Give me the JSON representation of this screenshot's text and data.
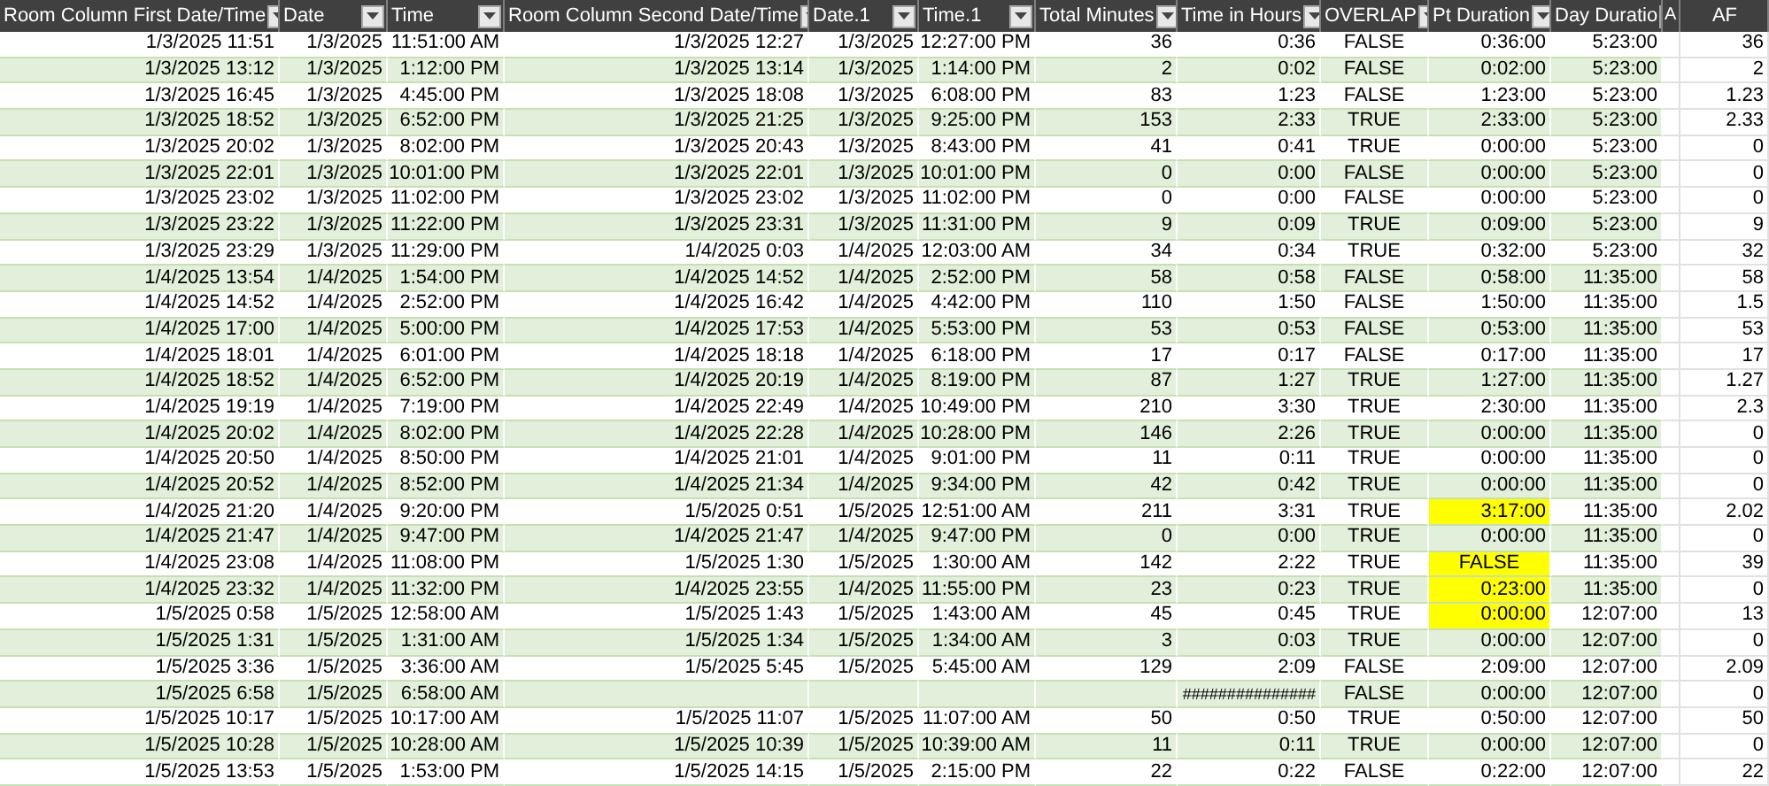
{
  "columns": [
    {
      "label": "Room Column First Date/Time",
      "filter": true
    },
    {
      "label": "Date",
      "filter": true
    },
    {
      "label": "Time",
      "filter": true
    },
    {
      "label": "Room Column Second Date/Time",
      "filter": true
    },
    {
      "label": "Date.1",
      "filter": true
    },
    {
      "label": "Time.1",
      "filter": true
    },
    {
      "label": "Total Minutes",
      "filter": true
    },
    {
      "label": "Time in Hours",
      "filter": true
    },
    {
      "label": "OVERLAP",
      "filter": true
    },
    {
      "label": "Pt Duration",
      "filter": true
    },
    {
      "label": "Day Duratio",
      "filter": true
    },
    {
      "label": "A",
      "filter": false,
      "kind": "narrow"
    },
    {
      "label": "AF",
      "filter": false
    }
  ],
  "rows": [
    {
      "cells": [
        "1/3/2025 11:51",
        "1/3/2025",
        "11:51:00 AM",
        "1/3/2025 12:27",
        "1/3/2025",
        "12:27:00 PM",
        "36",
        "0:36",
        "FALSE",
        "0:36:00",
        "5:23:00",
        null,
        "36"
      ],
      "highlight": false
    },
    {
      "cells": [
        "1/3/2025 13:12",
        "1/3/2025",
        "1:12:00 PM",
        "1/3/2025 13:14",
        "1/3/2025",
        "1:14:00 PM",
        "2",
        "0:02",
        "FALSE",
        "0:02:00",
        "5:23:00",
        null,
        "2"
      ],
      "highlight": false
    },
    {
      "cells": [
        "1/3/2025 16:45",
        "1/3/2025",
        "4:45:00 PM",
        "1/3/2025 18:08",
        "1/3/2025",
        "6:08:00 PM",
        "83",
        "1:23",
        "FALSE",
        "1:23:00",
        "5:23:00",
        null,
        "1.23"
      ],
      "highlight": false
    },
    {
      "cells": [
        "1/3/2025 18:52",
        "1/3/2025",
        "6:52:00 PM",
        "1/3/2025 21:25",
        "1/3/2025",
        "9:25:00 PM",
        "153",
        "2:33",
        "TRUE",
        "2:33:00",
        "5:23:00",
        null,
        "2.33"
      ],
      "highlight": false
    },
    {
      "cells": [
        "1/3/2025 20:02",
        "1/3/2025",
        "8:02:00 PM",
        "1/3/2025 20:43",
        "1/3/2025",
        "8:43:00 PM",
        "41",
        "0:41",
        "TRUE",
        "0:00:00",
        "5:23:00",
        null,
        "0"
      ],
      "highlight": false
    },
    {
      "cells": [
        "1/3/2025 22:01",
        "1/3/2025",
        "10:01:00 PM",
        "1/3/2025 22:01",
        "1/3/2025",
        "10:01:00 PM",
        "0",
        "0:00",
        "FALSE",
        "0:00:00",
        "5:23:00",
        null,
        "0"
      ],
      "highlight": false
    },
    {
      "cells": [
        "1/3/2025 23:02",
        "1/3/2025",
        "11:02:00 PM",
        "1/3/2025 23:02",
        "1/3/2025",
        "11:02:00 PM",
        "0",
        "0:00",
        "FALSE",
        "0:00:00",
        "5:23:00",
        null,
        "0"
      ],
      "highlight": false
    },
    {
      "cells": [
        "1/3/2025 23:22",
        "1/3/2025",
        "11:22:00 PM",
        "1/3/2025 23:31",
        "1/3/2025",
        "11:31:00 PM",
        "9",
        "0:09",
        "TRUE",
        "0:09:00",
        "5:23:00",
        null,
        "9"
      ],
      "highlight": false
    },
    {
      "cells": [
        "1/3/2025 23:29",
        "1/3/2025",
        "11:29:00 PM",
        "1/4/2025 0:03",
        "1/4/2025",
        "12:03:00 AM",
        "34",
        "0:34",
        "TRUE",
        "0:32:00",
        "5:23:00",
        null,
        "32"
      ],
      "highlight": false
    },
    {
      "cells": [
        "1/4/2025 13:54",
        "1/4/2025",
        "1:54:00 PM",
        "1/4/2025 14:52",
        "1/4/2025",
        "2:52:00 PM",
        "58",
        "0:58",
        "FALSE",
        "0:58:00",
        "11:35:00",
        null,
        "58"
      ],
      "highlight": false
    },
    {
      "cells": [
        "1/4/2025 14:52",
        "1/4/2025",
        "2:52:00 PM",
        "1/4/2025 16:42",
        "1/4/2025",
        "4:42:00 PM",
        "110",
        "1:50",
        "FALSE",
        "1:50:00",
        "11:35:00",
        null,
        "1.5"
      ],
      "highlight": false
    },
    {
      "cells": [
        "1/4/2025 17:00",
        "1/4/2025",
        "5:00:00 PM",
        "1/4/2025 17:53",
        "1/4/2025",
        "5:53:00 PM",
        "53",
        "0:53",
        "FALSE",
        "0:53:00",
        "11:35:00",
        null,
        "53"
      ],
      "highlight": false
    },
    {
      "cells": [
        "1/4/2025 18:01",
        "1/4/2025",
        "6:01:00 PM",
        "1/4/2025 18:18",
        "1/4/2025",
        "6:18:00 PM",
        "17",
        "0:17",
        "FALSE",
        "0:17:00",
        "11:35:00",
        null,
        "17"
      ],
      "highlight": false
    },
    {
      "cells": [
        "1/4/2025 18:52",
        "1/4/2025",
        "6:52:00 PM",
        "1/4/2025 20:19",
        "1/4/2025",
        "8:19:00 PM",
        "87",
        "1:27",
        "TRUE",
        "1:27:00",
        "11:35:00",
        null,
        "1.27"
      ],
      "highlight": false
    },
    {
      "cells": [
        "1/4/2025 19:19",
        "1/4/2025",
        "7:19:00 PM",
        "1/4/2025 22:49",
        "1/4/2025",
        "10:49:00 PM",
        "210",
        "3:30",
        "TRUE",
        "2:30:00",
        "11:35:00",
        null,
        "2.3"
      ],
      "highlight": false
    },
    {
      "cells": [
        "1/4/2025 20:02",
        "1/4/2025",
        "8:02:00 PM",
        "1/4/2025 22:28",
        "1/4/2025",
        "10:28:00 PM",
        "146",
        "2:26",
        "TRUE",
        "0:00:00",
        "11:35:00",
        null,
        "0"
      ],
      "highlight": false
    },
    {
      "cells": [
        "1/4/2025 20:50",
        "1/4/2025",
        "8:50:00 PM",
        "1/4/2025 21:01",
        "1/4/2025",
        "9:01:00 PM",
        "11",
        "0:11",
        "TRUE",
        "0:00:00",
        "11:35:00",
        null,
        "0"
      ],
      "highlight": false
    },
    {
      "cells": [
        "1/4/2025 20:52",
        "1/4/2025",
        "8:52:00 PM",
        "1/4/2025 21:34",
        "1/4/2025",
        "9:34:00 PM",
        "42",
        "0:42",
        "TRUE",
        "0:00:00",
        "11:35:00",
        null,
        "0"
      ],
      "highlight": false
    },
    {
      "cells": [
        "1/4/2025 21:20",
        "1/4/2025",
        "9:20:00 PM",
        "1/5/2025 0:51",
        "1/5/2025",
        "12:51:00 AM",
        "211",
        "3:31",
        "TRUE",
        "3:17:00",
        "11:35:00",
        null,
        "2.02"
      ],
      "highlight": true
    },
    {
      "cells": [
        "1/4/2025 21:47",
        "1/4/2025",
        "9:47:00 PM",
        "1/4/2025 21:47",
        "1/4/2025",
        "9:47:00 PM",
        "0",
        "0:00",
        "TRUE",
        "0:00:00",
        "11:35:00",
        null,
        "0"
      ],
      "highlight": false
    },
    {
      "cells": [
        "1/4/2025 23:08",
        "1/4/2025",
        "11:08:00 PM",
        "1/5/2025 1:30",
        "1/5/2025",
        "1:30:00 AM",
        "142",
        "2:22",
        "TRUE",
        {
          "text": "FALSE",
          "kind": "boolean"
        },
        "11:35:00",
        null,
        "39"
      ],
      "highlight": true
    },
    {
      "cells": [
        "1/4/2025 23:32",
        "1/4/2025",
        "11:32:00 PM",
        "1/4/2025 23:55",
        "1/4/2025",
        "11:55:00 PM",
        "23",
        "0:23",
        "TRUE",
        "0:23:00",
        "11:35:00",
        null,
        "0"
      ],
      "highlight": true
    },
    {
      "cells": [
        "1/5/2025 0:58",
        "1/5/2025",
        "12:58:00 AM",
        "1/5/2025 1:43",
        "1/5/2025",
        "1:43:00 AM",
        "45",
        "0:45",
        "TRUE",
        "0:00:00",
        "12:07:00",
        null,
        "13"
      ],
      "highlight": true
    },
    {
      "cells": [
        "1/5/2025 1:31",
        "1/5/2025",
        "1:31:00 AM",
        "1/5/2025 1:34",
        "1/5/2025",
        "1:34:00 AM",
        "3",
        "0:03",
        "TRUE",
        "0:00:00",
        "12:07:00",
        null,
        "0"
      ],
      "highlight": false
    },
    {
      "cells": [
        "1/5/2025 3:36",
        "1/5/2025",
        "3:36:00 AM",
        "1/5/2025 5:45",
        "1/5/2025",
        "5:45:00 AM",
        "129",
        "2:09",
        "FALSE",
        "2:09:00",
        "12:07:00",
        null,
        "2.09"
      ],
      "highlight": false
    },
    {
      "cells": [
        "1/5/2025 6:58",
        "1/5/2025",
        "6:58:00 AM",
        null,
        null,
        null,
        null,
        {
          "text": "###############",
          "kind": "overflow"
        },
        "FALSE",
        "0:00:00",
        "12:07:00",
        null,
        "0"
      ],
      "highlight": false
    },
    {
      "cells": [
        "1/5/2025 10:17",
        "1/5/2025",
        "10:17:00 AM",
        "1/5/2025 11:07",
        "1/5/2025",
        "11:07:00 AM",
        "50",
        "0:50",
        "TRUE",
        "0:50:00",
        "12:07:00",
        null,
        "50"
      ],
      "highlight": false
    },
    {
      "cells": [
        "1/5/2025 10:28",
        "1/5/2025",
        "10:28:00 AM",
        "1/5/2025 10:39",
        "1/5/2025",
        "10:39:00 AM",
        "11",
        "0:11",
        "TRUE",
        "0:00:00",
        "12:07:00",
        null,
        "0"
      ],
      "highlight": false
    },
    {
      "cells": [
        "1/5/2025 13:53",
        "1/5/2025",
        "1:53:00 PM",
        "1/5/2025 14:15",
        "1/5/2025",
        "2:15:00 PM",
        "22",
        "0:22",
        "FALSE",
        "0:22:00",
        "12:07:00",
        null,
        "22"
      ],
      "highlight": false
    }
  ]
}
